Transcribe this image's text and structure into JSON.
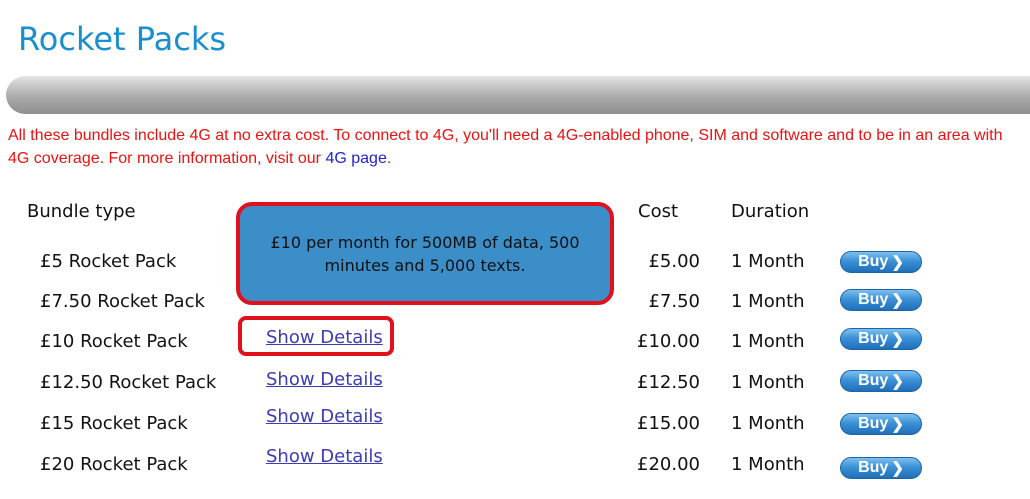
{
  "page": {
    "title": "Rocket Packs",
    "notice_text": "All these bundles include 4G at no extra cost. To connect to 4G, you'll need a 4G-enabled phone, SIM and software and to be in an area with 4G coverage. For more information, visit our ",
    "notice_link": "4G page",
    "notice_end": "."
  },
  "table": {
    "headers": {
      "bundle_type": "Bundle type",
      "cost": "Cost",
      "duration": "Duration"
    },
    "rows": [
      {
        "name": "£5 Rocket Pack",
        "cost": "£5.00",
        "duration": "1 Month",
        "details_label": "",
        "buy_label": "Buy"
      },
      {
        "name": "£7.50 Rocket Pack",
        "cost": "£7.50",
        "duration": "1 Month",
        "details_label": "",
        "buy_label": "Buy"
      },
      {
        "name": "£10 Rocket Pack",
        "cost": "£10.00",
        "duration": "1 Month",
        "details_label": "Show Details",
        "buy_label": "Buy"
      },
      {
        "name": "£12.50 Rocket Pack",
        "cost": "£12.50",
        "duration": "1 Month",
        "details_label": "Show Details",
        "buy_label": "Buy"
      },
      {
        "name": "£15 Rocket Pack",
        "cost": "£15.00",
        "duration": "1 Month",
        "details_label": "Show Details",
        "buy_label": "Buy"
      },
      {
        "name": "£20 Rocket Pack",
        "cost": "£20.00",
        "duration": "1 Month",
        "details_label": "Show Details",
        "buy_label": "Buy"
      }
    ]
  },
  "popup": {
    "text": "£10 per month for 500MB of data, 500 minutes and 5,000 texts."
  },
  "icons": {
    "buy_chevron": "chevron-right-icon"
  },
  "colors": {
    "title": "#1a8fd0",
    "notice": "#ee1111",
    "link": "#1f1fd6",
    "popup_bg": "#3c8ec9",
    "highlight_border": "#e0101c",
    "buy_button": "#3b91d6"
  }
}
